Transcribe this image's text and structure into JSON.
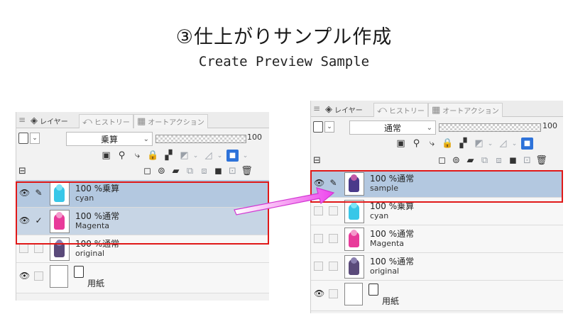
{
  "title": "③仕上がりサンプル作成",
  "subtitle": "Create Preview Sample",
  "tabs": [
    {
      "icon": "layers-icon",
      "label": "レイヤー"
    },
    {
      "icon": "history-icon",
      "label": "ヒストリー"
    },
    {
      "icon": "auto-action-icon",
      "label": "オートアクション"
    }
  ],
  "left_panel": {
    "blend_mode": "乗算",
    "opacity": "100",
    "layers": [
      {
        "name": "100 %乗算",
        "sub": "cyan",
        "state": "selected",
        "visible": true,
        "icon": "pen",
        "color": "cyan"
      },
      {
        "name": "100 %通常",
        "sub": "Magenta",
        "state": "selected",
        "visible": true,
        "icon": "check",
        "color": "magenta"
      },
      {
        "name": "100 %通常",
        "sub": "original",
        "state": "normal",
        "visible": false,
        "icon": "",
        "color": "original"
      },
      {
        "name": "",
        "sub": "用紙",
        "state": "paper",
        "visible": true,
        "icon": "",
        "color": "paper"
      }
    ]
  },
  "right_panel": {
    "blend_mode": "通常",
    "opacity": "100",
    "layers": [
      {
        "name": "100 %通常",
        "sub": "sample",
        "state": "selected",
        "visible": true,
        "icon": "pen",
        "color": "sample"
      },
      {
        "name": "100 %乗算",
        "sub": "cyan",
        "state": "normal",
        "visible": false,
        "icon": "",
        "color": "cyan"
      },
      {
        "name": "100 %通常",
        "sub": "Magenta",
        "state": "normal",
        "visible": false,
        "icon": "",
        "color": "magenta"
      },
      {
        "name": "100 %通常",
        "sub": "original",
        "state": "normal",
        "visible": false,
        "icon": "",
        "color": "original"
      },
      {
        "name": "",
        "sub": "用紙",
        "state": "paper",
        "visible": true,
        "icon": "",
        "color": "paper"
      }
    ]
  },
  "colors": {
    "selected_row": "#b3c8e0",
    "highlight_box": "#e01818",
    "arrow": "#ee44ee",
    "cyan_thumb": "#38c7e8",
    "magenta_thumb": "#e83a9a",
    "original_thumb": "#5a4a7a",
    "sample_thumb": "#4a3a8a"
  }
}
